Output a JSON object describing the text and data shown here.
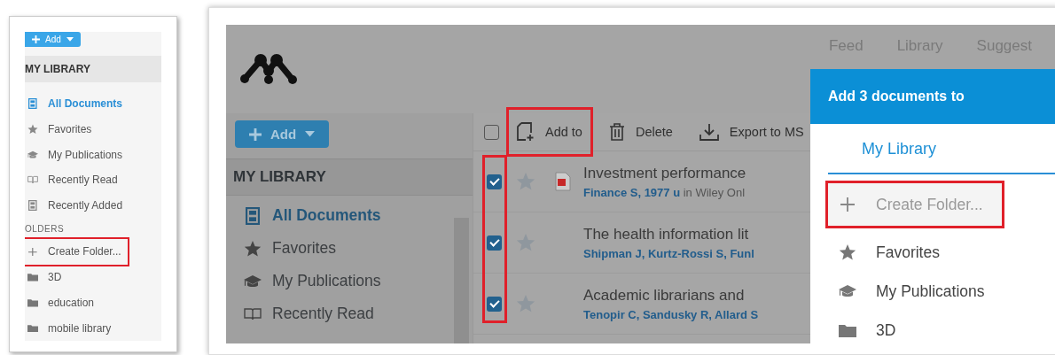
{
  "help_panel": {
    "add_button": "Add",
    "library_header": "MY LIBRARY",
    "items": [
      {
        "label": "All Documents",
        "kind": "all",
        "selected": true
      },
      {
        "label": "Favorites",
        "kind": "star",
        "selected": false
      },
      {
        "label": "My Publications",
        "kind": "cap",
        "selected": false
      },
      {
        "label": "Recently Read",
        "kind": "book",
        "selected": false
      },
      {
        "label": "Recently Added",
        "kind": "recent",
        "selected": false
      }
    ],
    "folders_label": "OLDERS",
    "folders": [
      {
        "label": "Create Folder...",
        "kind": "create",
        "highlighted": true
      },
      {
        "label": "3D",
        "kind": "folder",
        "highlighted": false
      },
      {
        "label": "education",
        "kind": "folder",
        "highlighted": false
      },
      {
        "label": "mobile library",
        "kind": "folder",
        "highlighted": false
      }
    ]
  },
  "app": {
    "nav": [
      "Feed",
      "Library",
      "Suggest"
    ],
    "add_button": "Add",
    "library_header": "MY LIBRARY",
    "items": [
      {
        "label": "All Documents",
        "kind": "all",
        "selected": true
      },
      {
        "label": "Favorites",
        "kind": "star",
        "selected": false
      },
      {
        "label": "My Publications",
        "kind": "cap",
        "selected": false
      },
      {
        "label": "Recently Read",
        "kind": "book",
        "selected": false
      }
    ],
    "select_all_checked": false,
    "actions": [
      {
        "label": "Add to",
        "kind": "add",
        "highlighted": true
      },
      {
        "label": "Delete",
        "kind": "delete",
        "highlighted": false
      },
      {
        "label": "Export to MS",
        "kind": "export",
        "highlighted": false
      }
    ],
    "checkboxes_highlighted": true,
    "documents": [
      {
        "checked": true,
        "starred": false,
        "has_pdf": true,
        "title": "Investment performance",
        "authors": "Finance S, 1977 u",
        "source": "in Wiley Onl"
      },
      {
        "checked": true,
        "starred": false,
        "has_pdf": false,
        "title": "The health information lit",
        "authors": "Shipman J, Kurtz-Rossi S, Funl"
      },
      {
        "checked": true,
        "starred": false,
        "has_pdf": false,
        "title": "Academic librarians and",
        "authors": "Tenopir C, Sandusky R, Allard S"
      }
    ]
  },
  "dialog": {
    "title": "Add 3 documents to",
    "tab": {
      "label": "My Library",
      "selected": true
    },
    "items": [
      {
        "label": "Create Folder...",
        "kind": "create",
        "highlighted": true
      },
      {
        "label": "Favorites",
        "kind": "star",
        "highlighted": false
      },
      {
        "label": "My Publications",
        "kind": "cap",
        "highlighted": false
      },
      {
        "label": "3D",
        "kind": "folder",
        "highlighted": false
      }
    ]
  }
}
